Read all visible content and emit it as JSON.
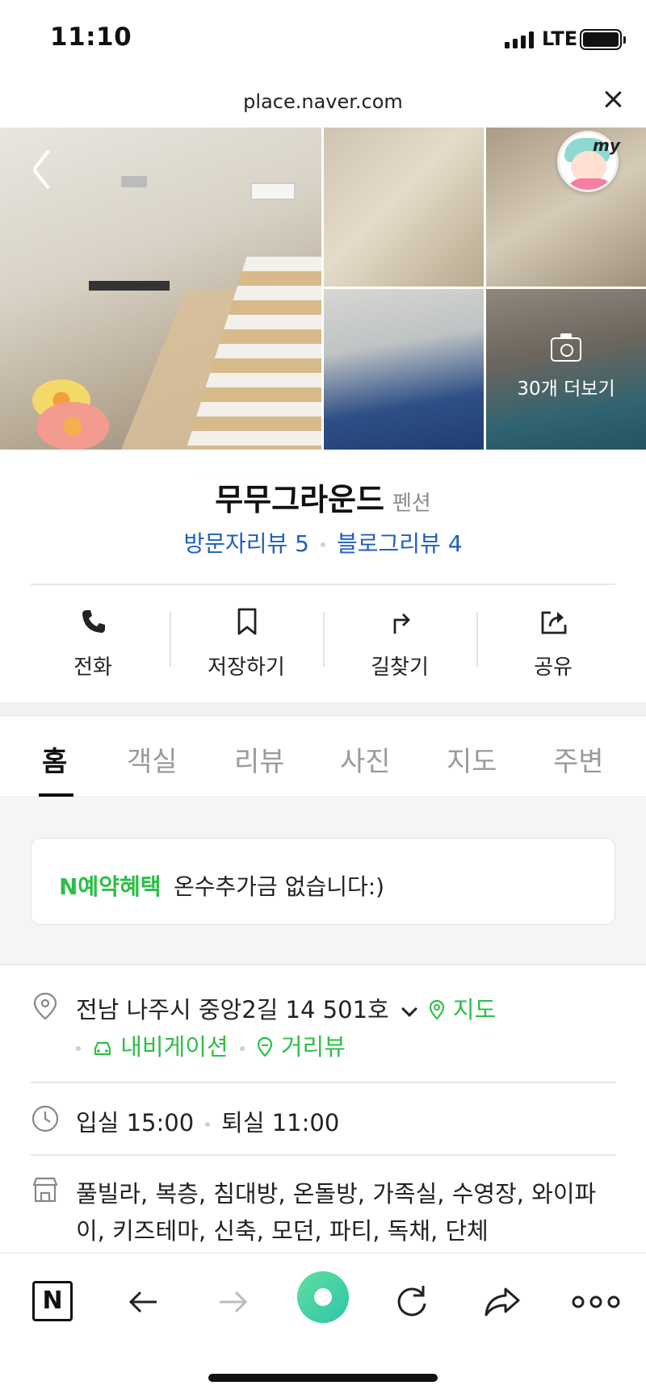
{
  "status_bar": {
    "time": "11:10",
    "network": "LTE",
    "signal_bars": 4,
    "battery_level": 1.0
  },
  "browser": {
    "url": "place.naver.com"
  },
  "gallery": {
    "more_photos_label": "30개 더보기",
    "avatar_label": "my"
  },
  "place": {
    "name": "무무그라운드",
    "category": "펜션",
    "visitor_review_label": "방문자리뷰 5",
    "blog_review_label": "블로그리뷰 4"
  },
  "actions": [
    {
      "label": "전화",
      "icon": "phone-icon"
    },
    {
      "label": "저장하기",
      "icon": "bookmark-icon"
    },
    {
      "label": "길찾기",
      "icon": "directions-icon"
    },
    {
      "label": "공유",
      "icon": "share-icon"
    }
  ],
  "tabs": [
    {
      "label": "홈",
      "active": true
    },
    {
      "label": "객실"
    },
    {
      "label": "리뷰"
    },
    {
      "label": "사진"
    },
    {
      "label": "지도"
    },
    {
      "label": "주변"
    }
  ],
  "notice": {
    "brand": "N예약혜택",
    "text": "온수추가금 없습니다:)"
  },
  "info": {
    "address": "전남 나주시 중앙2길 14 501호",
    "map_link": "지도",
    "navigation_link": "내비게이션",
    "street_view_link": "거리뷰",
    "checkin": "입실 15:00",
    "checkout": "퇴실 11:00",
    "amenities": "풀빌라, 복층, 침대방, 온돌방, 가족실, 수영장, 와이파이, 키즈테마, 신축, 모던, 파티, 독채, 단체"
  },
  "toolbar": {
    "logo_label": "N"
  },
  "colors": {
    "brand_green": "#2dbf47",
    "link_blue": "#1f5fbe",
    "muted_gray": "#9a9a9a"
  }
}
